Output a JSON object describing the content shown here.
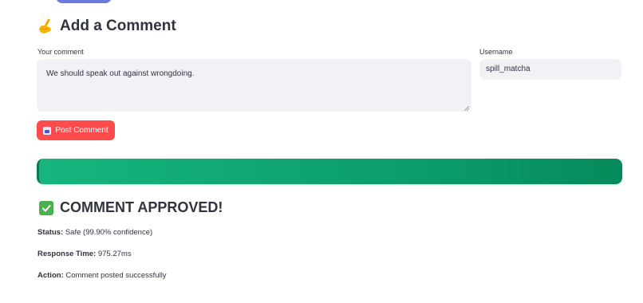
{
  "header": {
    "title": "Add a Comment",
    "icon": "writing-hand-icon"
  },
  "form": {
    "comment_label": "Your comment",
    "comment_value": "We should speak out against wrongdoing.",
    "username_label": "Username",
    "username_value": "spill_matcha",
    "post_button_label": "Post Comment",
    "post_button_icon": "inbox-tray-icon",
    "post_button_color": "#ff4b4b"
  },
  "progress": {
    "fraction": 1.0,
    "color": "#0a9a68"
  },
  "result": {
    "title": "COMMENT APPROVED!",
    "icon": "check-mark-icon",
    "status_label": "Status:",
    "status_value": "Safe (99.90% confidence)",
    "response_time_label": "Response Time:",
    "response_time_value": "975.27ms",
    "action_label": "Action:",
    "action_value": "Comment posted successfully"
  }
}
